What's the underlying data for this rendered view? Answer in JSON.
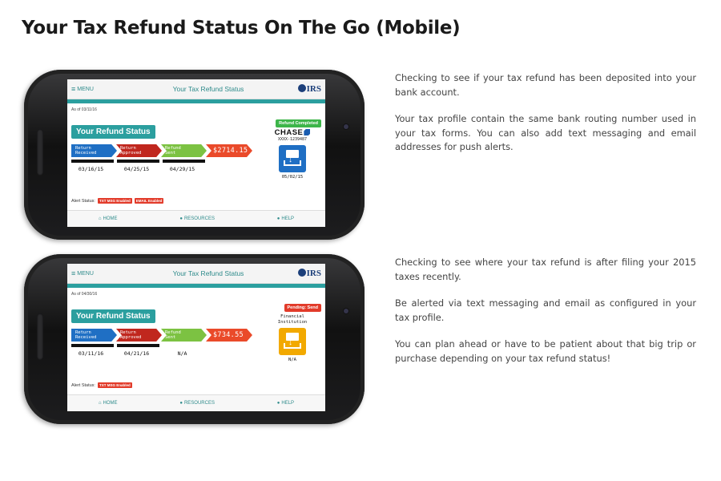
{
  "page": {
    "title": "Your Tax Refund Status On The Go (Mobile)"
  },
  "phones": [
    {
      "menu_label": "MENU",
      "app_title": "Your Tax Refund Status",
      "irs_logo": "IRS",
      "as_of": "As of 03/11/16",
      "refund_heading": "Your Refund Status",
      "status_badge": "Refund Completed",
      "status_color": "#3db54a",
      "steps": [
        {
          "line1": "Return",
          "line2": "Received"
        },
        {
          "line1": "Return",
          "line2": "Approved"
        },
        {
          "line1": "Refund",
          "line2": "Sent"
        }
      ],
      "amount": "$2714.15",
      "dates": [
        "03/16/15",
        "04/25/15",
        "04/29/15"
      ],
      "bank_name": "CHASE",
      "bank_account": "XXXX-1239487",
      "deposit_icon": "bank-deposit-icon",
      "deposit_date": "05/02/15",
      "alert_label": "Alert Status:",
      "alert_badges": [
        "TXT MSG Enabled",
        "EMAIL Enabled"
      ],
      "nav": {
        "home": "HOME",
        "resources": "RESOURCES",
        "help": "HELP"
      }
    },
    {
      "menu_label": "MENU",
      "app_title": "Your Tax Refund Status",
      "irs_logo": "IRS",
      "as_of": "As of 04/30/16",
      "refund_heading": "Your Refund Status",
      "status_badge": "Pending: Send",
      "status_color": "#e23b2a",
      "steps": [
        {
          "line1": "Return",
          "line2": "Received"
        },
        {
          "line1": "Return",
          "line2": "Approved"
        },
        {
          "line1": "Refund",
          "line2": "Sent"
        }
      ],
      "amount": "$734.55",
      "dates": [
        "03/11/16",
        "04/21/16",
        "N/A"
      ],
      "bank_line1": "Financial",
      "bank_line2": "Institution",
      "deposit_icon": "bank-deposit-icon",
      "deposit_date": "N/A",
      "alert_label": "Alert Status:",
      "alert_badges": [
        "TXT MSG Enabled"
      ],
      "nav": {
        "home": "HOME",
        "resources": "RESOURCES",
        "help": "HELP"
      }
    }
  ],
  "descriptions": [
    {
      "paragraphs": [
        "Checking to see if your tax refund has been deposited into your bank account.",
        "Your tax profile contain the same bank routing number used in your tax forms. You can also add text messaging and email addresses for push alerts."
      ]
    },
    {
      "paragraphs": [
        "Checking to see where your tax refund is after filing your 2015 taxes recently.",
        "Be alerted via text messaging and email as configured in your tax profile.",
        "You can plan ahead or have to be patient about that big trip or purchase depending on your tax refund status!"
      ]
    }
  ]
}
